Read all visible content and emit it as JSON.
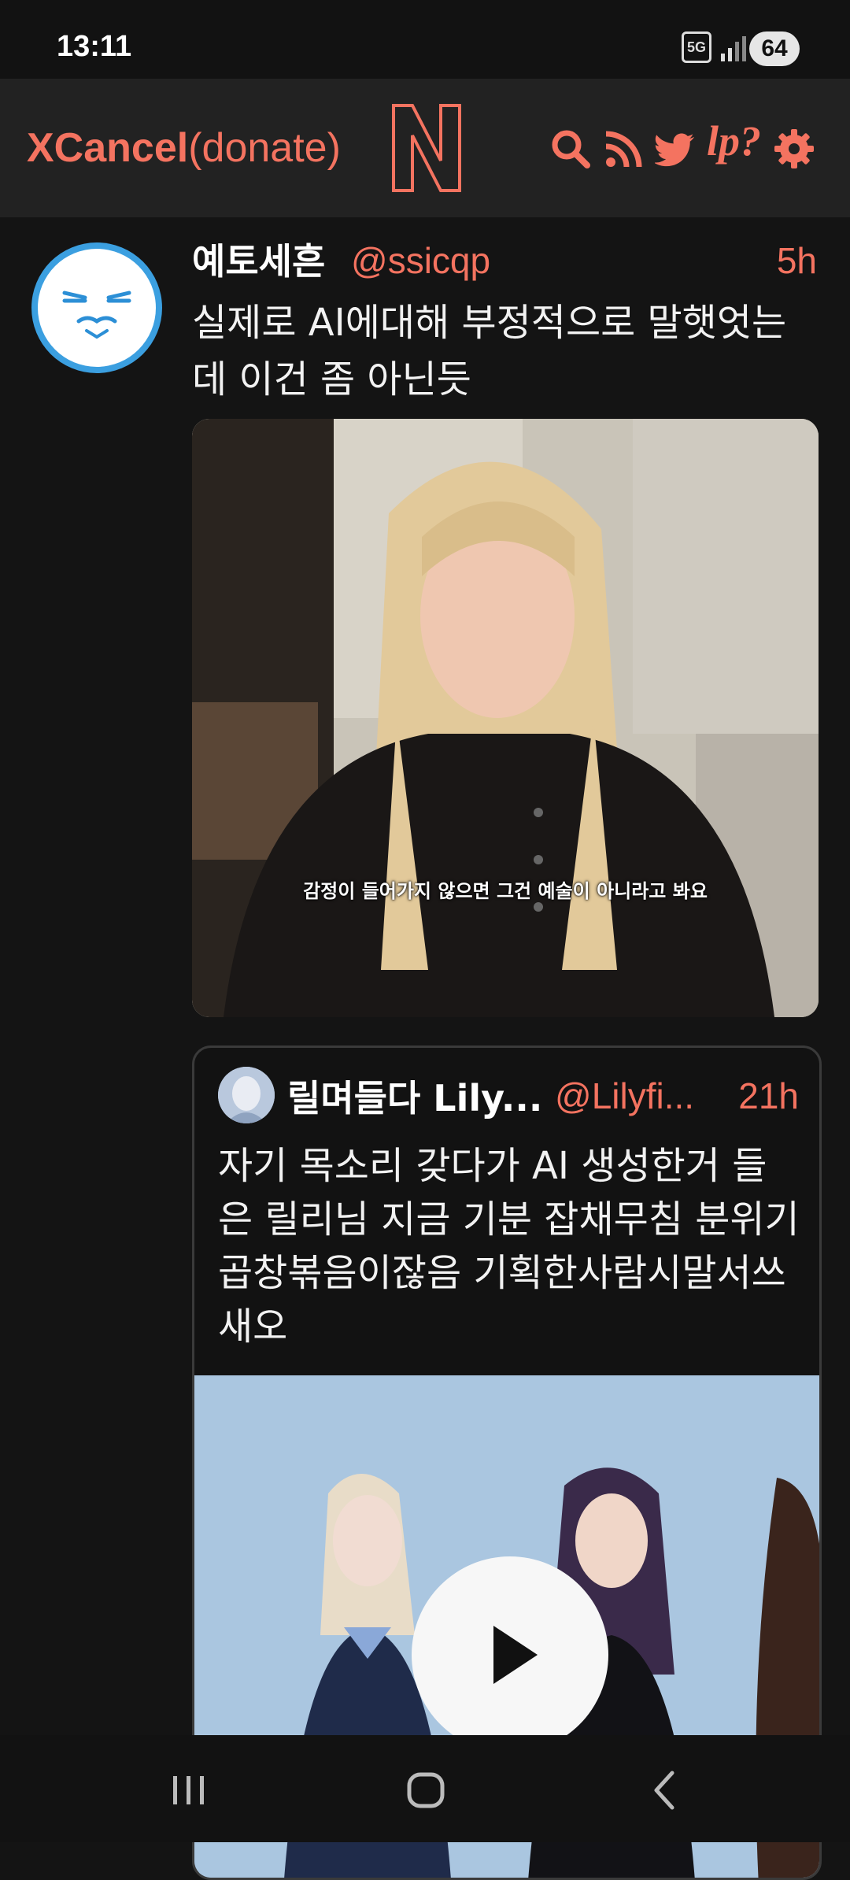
{
  "status_bar": {
    "time": "13:11",
    "network": "5G",
    "battery": "64"
  },
  "header": {
    "brand_bold": "XCancel",
    "brand_rest": "(donate)",
    "logo_letter": "N",
    "icons": [
      "search-icon",
      "rss-icon",
      "twitter-bird-icon",
      "lp-question-icon",
      "gear-icon"
    ],
    "lp_label": "lp?"
  },
  "tweet": {
    "author_name": "예토세흔",
    "handle": "@ssicqp",
    "time": "5h",
    "text": "실제로 AI에대해 부정적으로 말햇엇는데 이건 좀 아닌듯",
    "media_caption": "감정이 들어가지 않으면 그건 예술이 아니라고 봐요"
  },
  "quoted_tweet": {
    "author_name": "릴며들다 Lily...",
    "handle": "@Lilyfi...",
    "time": "21h",
    "text": "자기 목소리 갖다가 AI 생성한거 들은 릴리님 지금 기분 잡채무침 분위기 곱창볶음이잖음 기획한사람시말서쓰새오"
  },
  "nav_bar": {
    "buttons": [
      "recent-apps",
      "home",
      "back"
    ]
  },
  "colors": {
    "accent": "#f47360",
    "background": "#141414",
    "header": "#222222"
  }
}
